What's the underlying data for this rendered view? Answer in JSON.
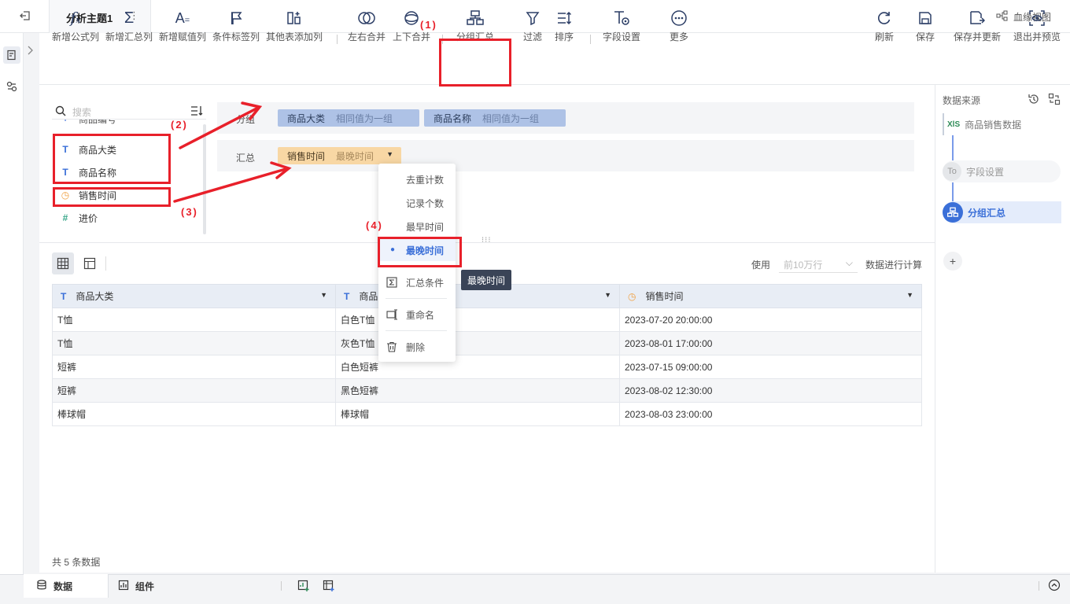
{
  "topbar": {
    "tab_title": "分析主题1",
    "tab_more": "⋮",
    "lineage_label": "血缘视图"
  },
  "toolbar": {
    "buttons": [
      {
        "label": "新增公式列",
        "icon": "formula-icon"
      },
      {
        "label": "新增汇总列",
        "icon": "sigma-icon"
      },
      {
        "label": "新增赋值列",
        "icon": "assign-icon"
      },
      {
        "label": "条件标签列",
        "icon": "flag-icon"
      },
      {
        "label": "其他表添加列",
        "icon": "add-column-icon"
      },
      {
        "label": "左右合并",
        "icon": "merge-horizontal-icon"
      },
      {
        "label": "上下合并",
        "icon": "merge-vertical-icon"
      },
      {
        "label": "分组汇总",
        "icon": "group-summary-icon"
      },
      {
        "label": "过滤",
        "icon": "filter-icon"
      },
      {
        "label": "排序",
        "icon": "sort-icon"
      },
      {
        "label": "字段设置",
        "icon": "field-settings-icon"
      },
      {
        "label": "更多",
        "icon": "more-icon"
      }
    ],
    "right_buttons": [
      {
        "label": "刷新",
        "icon": "refresh-icon"
      },
      {
        "label": "保存",
        "icon": "save-icon"
      },
      {
        "label": "保存并更新",
        "icon": "save-update-icon"
      },
      {
        "label": "退出并预览",
        "icon": "preview-icon"
      }
    ]
  },
  "fields": {
    "search_placeholder": "搜索",
    "partial_item": "商品编号",
    "items": [
      {
        "label": "商品大类",
        "type_icon": "T"
      },
      {
        "label": "商品名称",
        "type_icon": "T"
      },
      {
        "label": "销售时间",
        "type_icon": "◷"
      },
      {
        "label": "进价",
        "type_icon": "#"
      }
    ]
  },
  "config": {
    "group_label": "分组",
    "summary_label": "汇总",
    "group_chips": [
      {
        "name": "商品大类",
        "sub": "相同值为一组"
      },
      {
        "name": "商品名称",
        "sub": "相同值为一组"
      }
    ],
    "summary_chip": {
      "name": "销售时间",
      "sub": "最晚时间"
    }
  },
  "menu": {
    "items": [
      "去重计数",
      "记录个数",
      "最早时间",
      "最晚时间"
    ],
    "selected": "最晚时间",
    "actions": [
      "汇总条件",
      "重命名",
      "删除"
    ],
    "tooltip": "最晚时间"
  },
  "data_area": {
    "use_label": "使用",
    "rows_select": "前10万行",
    "calc_label": "数据进行计算",
    "columns": [
      {
        "label": "商品大类",
        "type_icon": "T"
      },
      {
        "label": "商品名称",
        "type_icon": "T"
      },
      {
        "label": "销售时间",
        "type_icon": "◷"
      }
    ],
    "rows": [
      [
        "T恤",
        "白色T恤",
        "2023-07-20 20:00:00"
      ],
      [
        "T恤",
        "灰色T恤",
        "2023-08-01 17:00:00"
      ],
      [
        "短裤",
        "白色短裤",
        "2023-07-15 09:00:00"
      ],
      [
        "短裤",
        "黑色短裤",
        "2023-08-02 12:30:00"
      ],
      [
        "棒球帽",
        "棒球帽",
        "2023-08-03 23:00:00"
      ]
    ],
    "count_label": "共 5 条数据"
  },
  "right_panel": {
    "title": "数据来源",
    "source_badge": "XlS",
    "source_name": "商品销售数据",
    "step1_badge": "To",
    "step1": "字段设置",
    "step2": "分组汇总",
    "add": "+"
  },
  "bottom": {
    "tab_data": "数据",
    "tab_components": "组件"
  },
  "annotations": {
    "a1": "(1)",
    "a2": "(2)",
    "a3": "(3)",
    "a4": "(4)"
  },
  "colors": {
    "accent_blue": "#3a6fd8",
    "annotation_red": "#e8202a",
    "chip_blue": "#aec2e6",
    "chip_orange": "#f8d7a4"
  }
}
